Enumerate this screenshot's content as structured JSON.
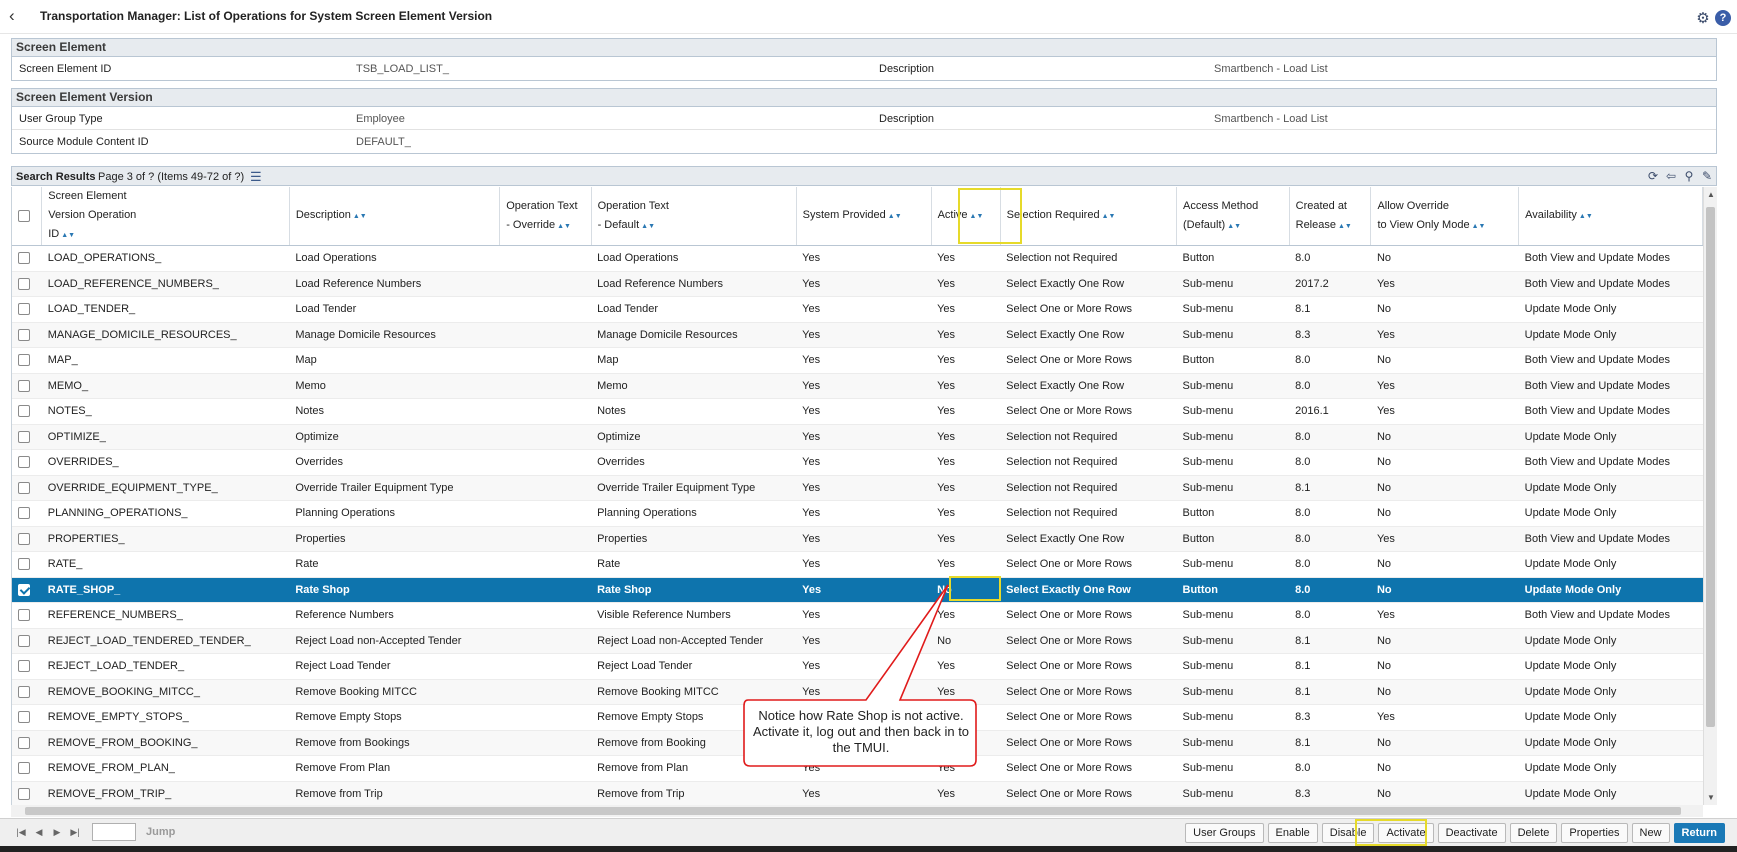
{
  "header": {
    "title": "Transportation Manager: List of Operations for System Screen Element Version",
    "back_icon": "chevron-left-icon"
  },
  "screen_element": {
    "heading": "Screen Element",
    "id_label": "Screen Element ID",
    "id_value": "TSB_LOAD_LIST_",
    "desc_label": "Description",
    "desc_value": "Smartbench - Load List"
  },
  "screen_element_version": {
    "heading": "Screen Element Version",
    "ugt_label": "User Group Type",
    "ugt_value": "Employee",
    "desc_label": "Description",
    "desc_value": "Smartbench - Load List",
    "smc_label": "Source Module Content ID",
    "smc_value": "DEFAULT_"
  },
  "results": {
    "label": "Search Results",
    "page_text": "Page 3 of ? (Items 49-72 of ?)"
  },
  "columns": [
    {
      "l1": "Screen Element",
      "l2": "Version Operation",
      "l3": "ID"
    },
    {
      "l1": "Description"
    },
    {
      "l1": "Operation Text",
      "l2": "- Override"
    },
    {
      "l1": "Operation Text",
      "l2": "- Default"
    },
    {
      "l1": "System Provided"
    },
    {
      "l1": "Active"
    },
    {
      "l1": "Selection Required"
    },
    {
      "l1": "Access Method",
      "l2": "(Default)"
    },
    {
      "l1": "Created at",
      "l2": "Release"
    },
    {
      "l1": "Allow Override",
      "l2": "to View Only Mode"
    },
    {
      "l1": "Availability"
    }
  ],
  "rows": [
    [
      "LOAD_OPERATIONS_",
      "Load Operations",
      "",
      "Load Operations",
      "Yes",
      "Yes",
      "Selection not Required",
      "Button",
      "8.0",
      "No",
      "Both View and Update Modes"
    ],
    [
      "LOAD_REFERENCE_NUMBERS_",
      "Load Reference Numbers",
      "",
      "Load Reference Numbers",
      "Yes",
      "Yes",
      "Select Exactly One Row",
      "Sub-menu",
      "2017.2",
      "Yes",
      "Both View and Update Modes"
    ],
    [
      "LOAD_TENDER_",
      "Load Tender",
      "",
      "Load Tender",
      "Yes",
      "Yes",
      "Select One or More Rows",
      "Sub-menu",
      "8.1",
      "No",
      "Update Mode Only"
    ],
    [
      "MANAGE_DOMICILE_RESOURCES_",
      "Manage Domicile Resources",
      "",
      "Manage Domicile Resources",
      "Yes",
      "Yes",
      "Select Exactly One Row",
      "Sub-menu",
      "8.3",
      "Yes",
      "Update Mode Only"
    ],
    [
      "MAP_",
      "Map",
      "",
      "Map",
      "Yes",
      "Yes",
      "Select One or More Rows",
      "Button",
      "8.0",
      "No",
      "Both View and Update Modes"
    ],
    [
      "MEMO_",
      "Memo",
      "",
      "Memo",
      "Yes",
      "Yes",
      "Select Exactly One Row",
      "Sub-menu",
      "8.0",
      "Yes",
      "Both View and Update Modes"
    ],
    [
      "NOTES_",
      "Notes",
      "",
      "Notes",
      "Yes",
      "Yes",
      "Select One or More Rows",
      "Sub-menu",
      "2016.1",
      "Yes",
      "Both View and Update Modes"
    ],
    [
      "OPTIMIZE_",
      "Optimize",
      "",
      "Optimize",
      "Yes",
      "Yes",
      "Selection not Required",
      "Sub-menu",
      "8.0",
      "No",
      "Update Mode Only"
    ],
    [
      "OVERRIDES_",
      "Overrides",
      "",
      "Overrides",
      "Yes",
      "Yes",
      "Selection not Required",
      "Sub-menu",
      "8.0",
      "No",
      "Both View and Update Modes"
    ],
    [
      "OVERRIDE_EQUIPMENT_TYPE_",
      "Override Trailer Equipment Type",
      "",
      "Override Trailer Equipment Type",
      "Yes",
      "Yes",
      "Selection not Required",
      "Sub-menu",
      "8.1",
      "No",
      "Update Mode Only"
    ],
    [
      "PLANNING_OPERATIONS_",
      "Planning Operations",
      "",
      "Planning Operations",
      "Yes",
      "Yes",
      "Selection not Required",
      "Button",
      "8.0",
      "No",
      "Update Mode Only"
    ],
    [
      "PROPERTIES_",
      "Properties",
      "",
      "Properties",
      "Yes",
      "Yes",
      "Select Exactly One Row",
      "Button",
      "8.0",
      "Yes",
      "Both View and Update Modes"
    ],
    [
      "RATE_",
      "Rate",
      "",
      "Rate",
      "Yes",
      "Yes",
      "Select One or More Rows",
      "Sub-menu",
      "8.0",
      "No",
      "Update Mode Only"
    ],
    [
      "RATE_SHOP_",
      "Rate Shop",
      "",
      "Rate Shop",
      "Yes",
      "No",
      "Select Exactly One Row",
      "Button",
      "8.0",
      "No",
      "Update Mode Only"
    ],
    [
      "REFERENCE_NUMBERS_",
      "Reference Numbers",
      "",
      "Visible Reference Numbers",
      "Yes",
      "Yes",
      "Select One or More Rows",
      "Sub-menu",
      "8.0",
      "Yes",
      "Both View and Update Modes"
    ],
    [
      "REJECT_LOAD_TENDERED_TENDER_",
      "Reject Load non-Accepted Tender",
      "",
      "Reject Load non-Accepted Tender",
      "Yes",
      "No",
      "Select One or More Rows",
      "Sub-menu",
      "8.1",
      "No",
      "Update Mode Only"
    ],
    [
      "REJECT_LOAD_TENDER_",
      "Reject Load Tender",
      "",
      "Reject Load Tender",
      "Yes",
      "Yes",
      "Select One or More Rows",
      "Sub-menu",
      "8.1",
      "No",
      "Update Mode Only"
    ],
    [
      "REMOVE_BOOKING_MITCC_",
      "Remove Booking MITCC",
      "",
      "Remove Booking MITCC",
      "Yes",
      "Yes",
      "Select One or More Rows",
      "Sub-menu",
      "8.1",
      "No",
      "Update Mode Only"
    ],
    [
      "REMOVE_EMPTY_STOPS_",
      "Remove Empty Stops",
      "",
      "Remove Empty Stops",
      "Yes",
      "Yes",
      "Select One or More Rows",
      "Sub-menu",
      "8.3",
      "Yes",
      "Update Mode Only"
    ],
    [
      "REMOVE_FROM_BOOKING_",
      "Remove from Bookings",
      "",
      "Remove from Booking",
      "Yes",
      "Yes",
      "Select One or More Rows",
      "Sub-menu",
      "8.1",
      "No",
      "Update Mode Only"
    ],
    [
      "REMOVE_FROM_PLAN_",
      "Remove From Plan",
      "",
      "Remove from Plan",
      "Yes",
      "Yes",
      "Select One or More Rows",
      "Sub-menu",
      "8.0",
      "No",
      "Update Mode Only"
    ],
    [
      "REMOVE_FROM_TRIP_",
      "Remove from Trip",
      "",
      "Remove from Trip",
      "Yes",
      "Yes",
      "Select One or More Rows",
      "Sub-menu",
      "8.3",
      "No",
      "Update Mode Only"
    ]
  ],
  "selected_row": 13,
  "footer": {
    "jump_label": "Jump",
    "buttons": [
      "User Groups",
      "Enable",
      "Disable",
      "Activate",
      "Deactivate",
      "Delete",
      "Properties",
      "New",
      "Return"
    ]
  },
  "callout": {
    "text": "Notice how Rate Shop is not active. Activate it, log out and then back in to the TMUI."
  },
  "colors": {
    "selected_row": "#0e74ad",
    "highlight": "#e6da2a",
    "callout_border": "#e01b1b",
    "primary_button": "#1a79b6"
  }
}
